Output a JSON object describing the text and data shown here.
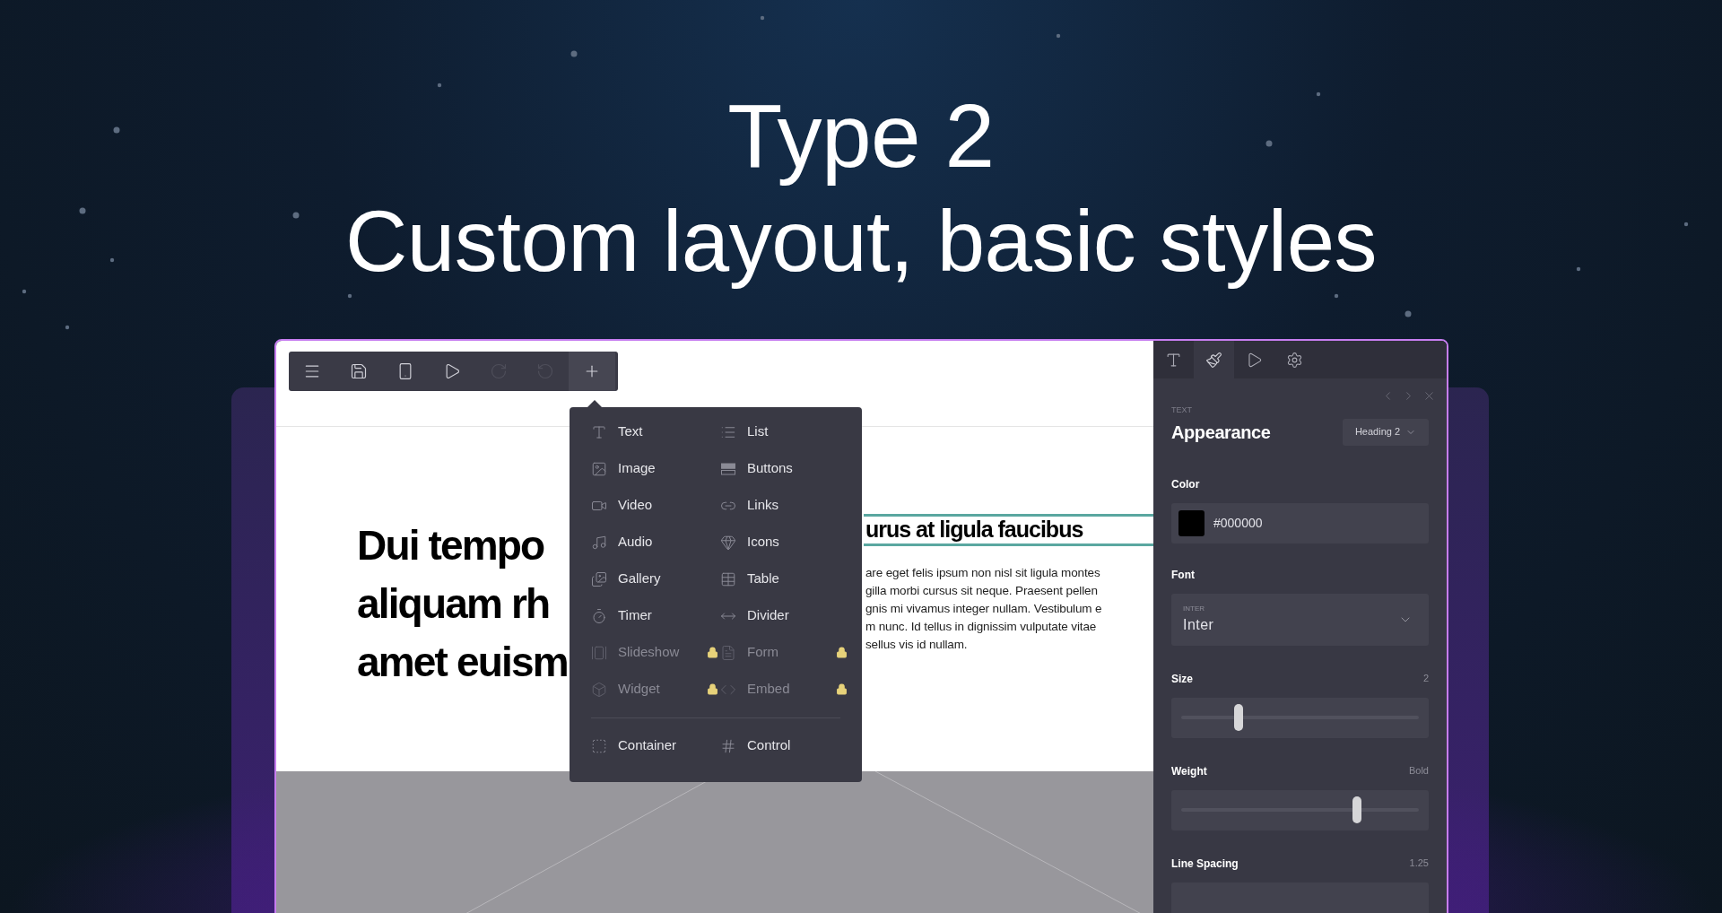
{
  "hero": {
    "title_line_1": "Type 2",
    "title_line_2": "Custom layout, basic styles"
  },
  "toolbar": [
    {
      "kind": "menu",
      "disabled": false,
      "selected": false
    },
    {
      "kind": "save",
      "disabled": false,
      "selected": false
    },
    {
      "kind": "mobile",
      "disabled": false,
      "selected": false
    },
    {
      "kind": "play",
      "disabled": false,
      "selected": false
    },
    {
      "kind": "redo",
      "disabled": true,
      "selected": false
    },
    {
      "kind": "undo",
      "disabled": true,
      "selected": false
    },
    {
      "kind": "add",
      "disabled": false,
      "selected": true
    }
  ],
  "menu": {
    "items": [
      {
        "label": "Text",
        "kind": "text",
        "locked": false
      },
      {
        "label": "List",
        "kind": "list",
        "locked": false
      },
      {
        "label": "Image",
        "kind": "image",
        "locked": false
      },
      {
        "label": "Buttons",
        "kind": "buttons",
        "locked": false
      },
      {
        "label": "Video",
        "kind": "video",
        "locked": false
      },
      {
        "label": "Links",
        "kind": "links",
        "locked": false
      },
      {
        "label": "Audio",
        "kind": "audio",
        "locked": false
      },
      {
        "label": "Icons",
        "kind": "icons",
        "locked": false
      },
      {
        "label": "Gallery",
        "kind": "gallery",
        "locked": false
      },
      {
        "label": "Table",
        "kind": "table",
        "locked": false
      },
      {
        "label": "Timer",
        "kind": "timer",
        "locked": false
      },
      {
        "label": "Divider",
        "kind": "divider",
        "locked": false
      },
      {
        "label": "Slideshow",
        "kind": "slideshow",
        "locked": true
      },
      {
        "label": "Form",
        "kind": "form",
        "locked": true
      },
      {
        "label": "Widget",
        "kind": "widget",
        "locked": true
      },
      {
        "label": "Embed",
        "kind": "embed",
        "locked": true
      }
    ],
    "footer": [
      {
        "label": "Container",
        "kind": "container",
        "locked": false
      },
      {
        "label": "Control",
        "kind": "control",
        "locked": false
      }
    ]
  },
  "canvas": {
    "heading_lines": [
      "Dui tempo",
      "aliquam rh",
      "amet euism"
    ],
    "subheading": "urus at ligula faucibus",
    "subheading_selected": true,
    "paragraph_lines": [
      "are eget felis ipsum non nisl sit ligula montes",
      "gilla morbi cursus sit neque. Praesent pellen",
      "gnis mi vivamus integer nullam. Vestibulum e",
      "m nunc. Id tellus in dignissim vulputate vitae",
      "sellus vis id nullam."
    ]
  },
  "panel": {
    "tabs": [
      {
        "kind": "text",
        "selected": false
      },
      {
        "kind": "style",
        "selected": true
      },
      {
        "kind": "play",
        "selected": false
      },
      {
        "kind": "settings",
        "selected": false
      }
    ],
    "section_label": "TEXT",
    "title": "Appearance",
    "preset": "Heading 2",
    "color_label": "Color",
    "color": "#000000",
    "font_label": "Font",
    "font_caption": "INTER",
    "font_value": "Inter",
    "sliders": [
      {
        "label": "Size",
        "reading": "2",
        "level": 0.24
      },
      {
        "label": "Weight",
        "reading": "Bold",
        "level": 0.74
      },
      {
        "label": "Line Spacing",
        "reading": "1.25"
      }
    ]
  }
}
